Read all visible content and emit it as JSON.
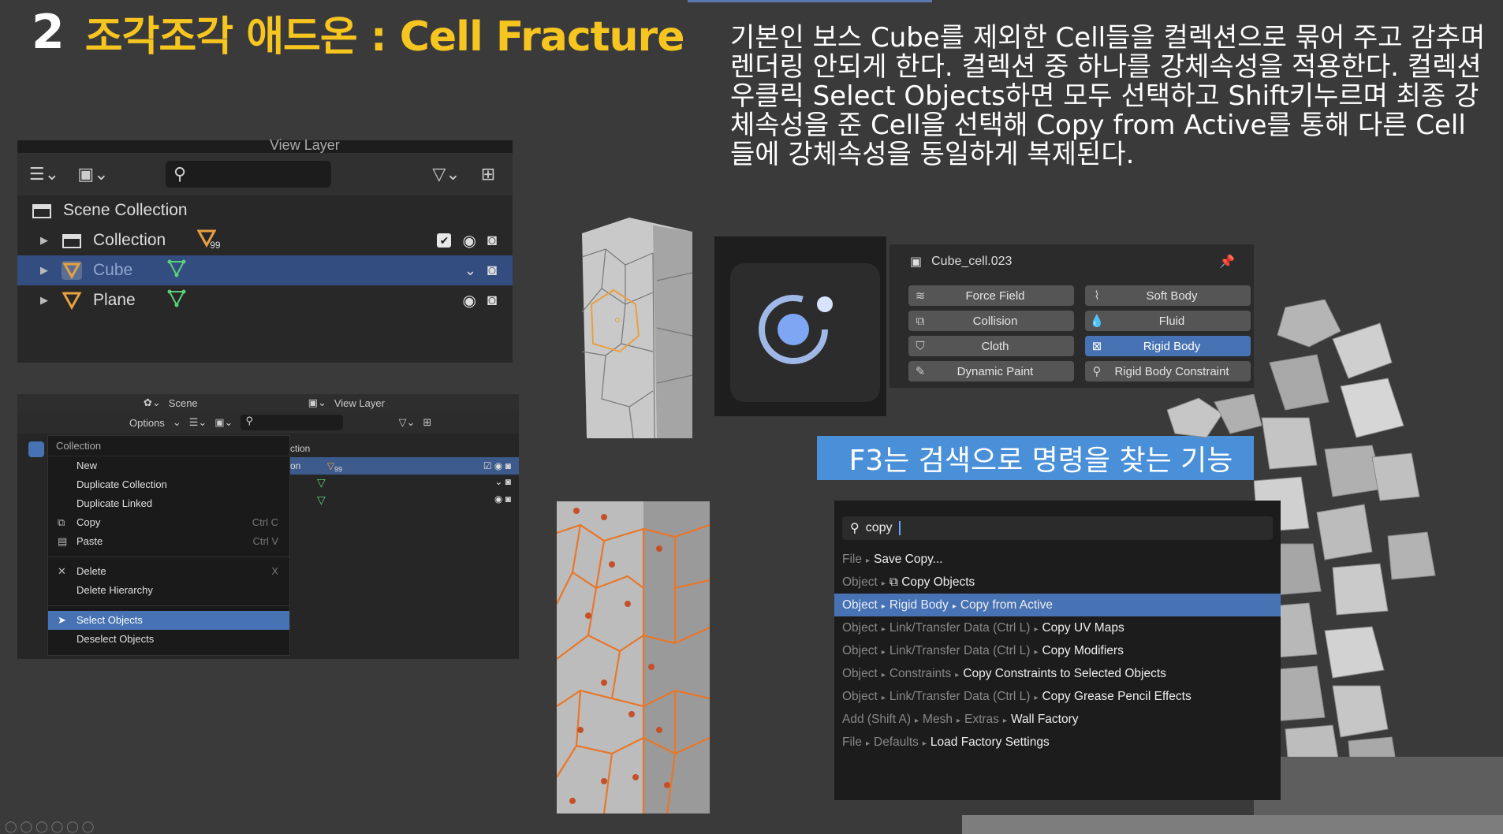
{
  "slide": {
    "number": "2",
    "heading": "조각조각 애드온 : Cell Fracture",
    "description": "기본인 보스 Cube를 제외한 Cell들을 컬렉션으로 묶어 주고 감추며 렌더링 안되게 한다. 컬렉션 중 하나를 강체속성을 적용한다. 컬렉션 우클릭 Select Objects하면 모두 선택하고 Shift키누르며 최종 강체속성을 준 Cell을 선택해 Copy from Active를 통해 다른 Cell 들에 강체속성을 동일하게 복제된다.",
    "banner": "F3는 검색으로 명령을 찾는 기능"
  },
  "outliner1": {
    "top_label": "View Layer",
    "rows": [
      {
        "label": "Scene Collection",
        "badge": ""
      },
      {
        "label": "Collection",
        "badge": "99"
      },
      {
        "label": "Cube",
        "badge": ""
      },
      {
        "label": "Plane",
        "badge": ""
      }
    ]
  },
  "outliner2": {
    "scene_label": "Scene",
    "view_layer_label": "View Layer",
    "options_label": "Options",
    "row_fragment_1": "ction",
    "row_fragment_2": "on",
    "row_badge": "99",
    "context_menu": {
      "title": "Collection",
      "items": [
        {
          "label": "New",
          "shortcut": ""
        },
        {
          "label": "Duplicate Collection",
          "shortcut": ""
        },
        {
          "label": "Duplicate Linked",
          "shortcut": ""
        },
        {
          "label": "Copy",
          "shortcut": "Ctrl C"
        },
        {
          "label": "Paste",
          "shortcut": "Ctrl V"
        },
        {
          "label": "Delete",
          "shortcut": "X"
        },
        {
          "label": "Delete Hierarchy",
          "shortcut": ""
        },
        {
          "label": "Select Objects",
          "shortcut": ""
        },
        {
          "label": "Deselect Objects",
          "shortcut": ""
        }
      ]
    }
  },
  "physics": {
    "object_name": "Cube_cell.023",
    "buttons": [
      {
        "label": "Force Field",
        "active": false
      },
      {
        "label": "Soft Body",
        "active": false
      },
      {
        "label": "Collision",
        "active": false
      },
      {
        "label": "Fluid",
        "active": false
      },
      {
        "label": "Cloth",
        "active": false
      },
      {
        "label": "Rigid Body",
        "active": true
      },
      {
        "label": "Dynamic Paint",
        "active": false
      },
      {
        "label": "Rigid Body Constraint",
        "active": false
      }
    ]
  },
  "search": {
    "query": "copy",
    "results": [
      {
        "path": [
          "File"
        ],
        "label": "Save Copy..."
      },
      {
        "path": [
          "Object"
        ],
        "label": "Copy Objects"
      },
      {
        "path": [
          "Object",
          "Rigid Body"
        ],
        "label": "Copy from Active"
      },
      {
        "path": [
          "Object",
          "Link/Transfer Data (Ctrl L)"
        ],
        "label": "Copy UV Maps"
      },
      {
        "path": [
          "Object",
          "Link/Transfer Data (Ctrl L)"
        ],
        "label": "Copy Modifiers"
      },
      {
        "path": [
          "Object",
          "Constraints"
        ],
        "label": "Copy Constraints to Selected Objects"
      },
      {
        "path": [
          "Object",
          "Link/Transfer Data (Ctrl L)"
        ],
        "label": "Copy Grease Pencil Effects"
      },
      {
        "path": [
          "Add (Shift A)",
          "Mesh",
          "Extras"
        ],
        "label": "Wall Factory"
      },
      {
        "path": [
          "File",
          "Defaults"
        ],
        "label": "Load Factory Settings"
      }
    ],
    "highlighted_index": 2
  },
  "colors": {
    "title_yellow": "#f7c51f",
    "accent_blue": "#4772b3",
    "banner_blue": "#4a90d9",
    "fracture_orange": "#e8772a"
  }
}
